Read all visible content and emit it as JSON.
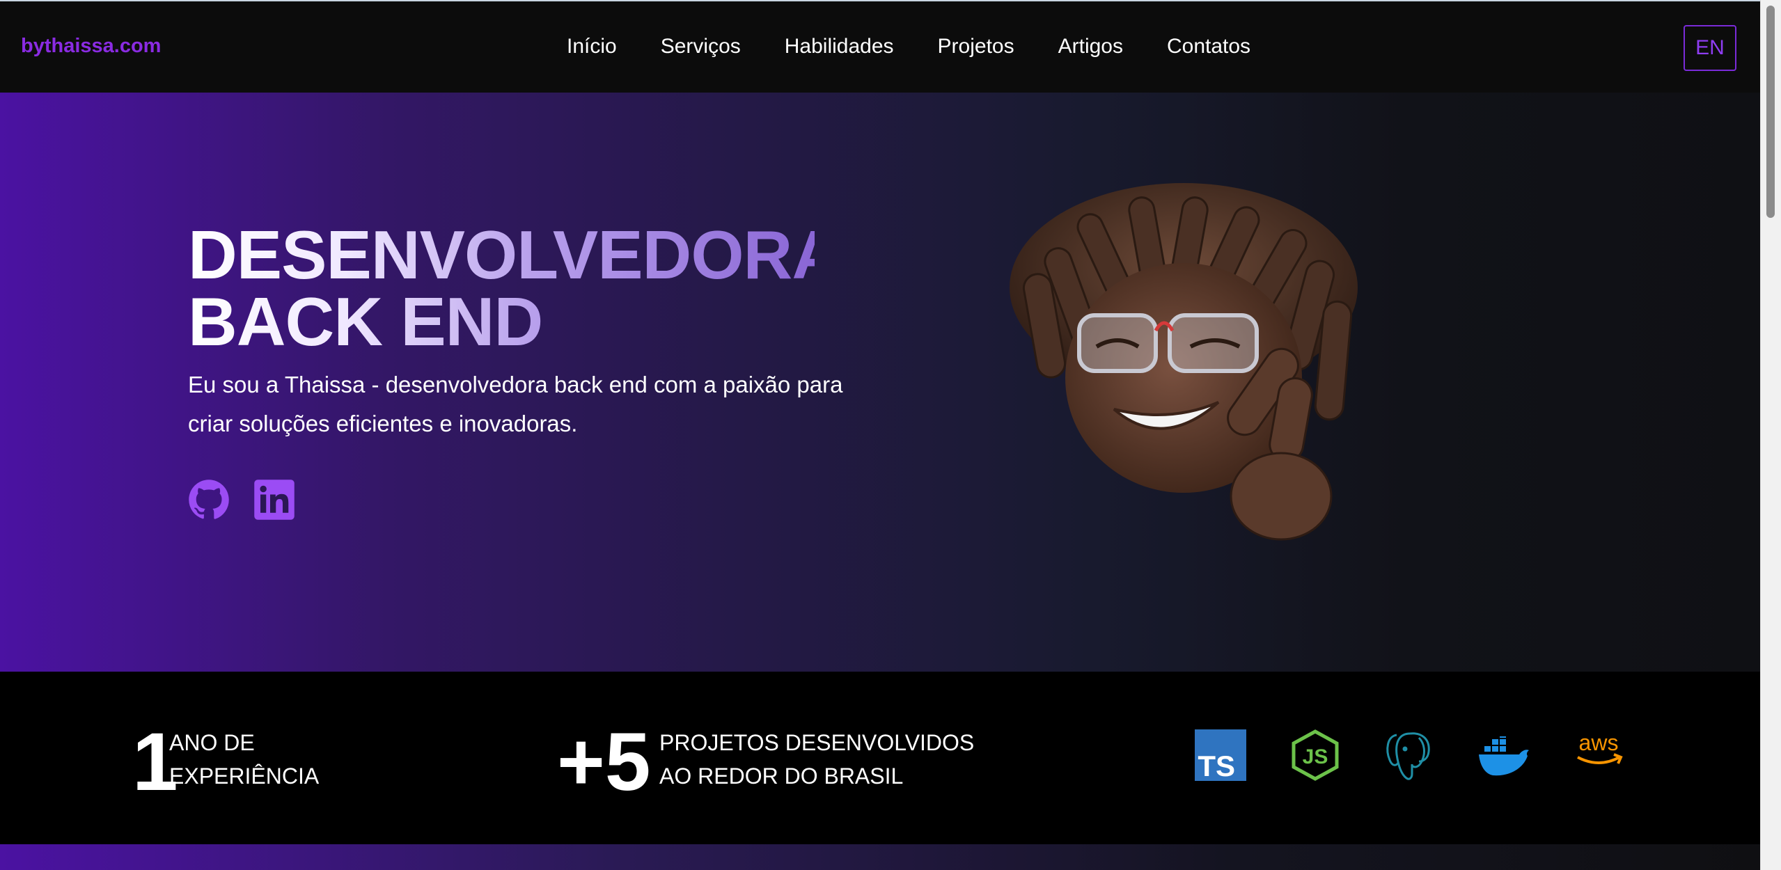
{
  "nav": {
    "brand": "bythaissa.com",
    "items": [
      {
        "label": "Início"
      },
      {
        "label": "Serviços"
      },
      {
        "label": "Habilidades"
      },
      {
        "label": "Projetos"
      },
      {
        "label": "Artigos"
      },
      {
        "label": "Contatos"
      }
    ],
    "language_button": "EN"
  },
  "hero": {
    "headline_line1": "DESENVOLVEDORA",
    "headline_line2": "BACK END",
    "subtitle": "Eu sou a Thaissa - desenvolvedora back end com a paixão para criar soluções eficientes e inovadoras.",
    "social_links": [
      {
        "icon": "github-icon"
      },
      {
        "icon": "linkedin-icon"
      }
    ],
    "avatar_icon": "memoji-avatar",
    "gradient_start": "#4b12a2",
    "gradient_end": "#0f1014"
  },
  "stats": {
    "experience": {
      "number": "1",
      "line1": "ANO DE",
      "line2": "EXPERIÊNCIA"
    },
    "projects": {
      "number": "+5",
      "line1": "PROJETOS DESENVOLVIDOS",
      "line2": "AO REDOR DO BRASIL"
    },
    "technologies": [
      {
        "icon": "typescript-icon",
        "label": "TS",
        "color": "#2f74c0"
      },
      {
        "icon": "nodejs-icon",
        "label": "JS",
        "color": "#6cc24a"
      },
      {
        "icon": "postgresql-icon",
        "color": "#1f8fa6"
      },
      {
        "icon": "docker-icon",
        "color": "#1d91e6"
      },
      {
        "icon": "aws-icon",
        "label": "aws",
        "color": "#f79400"
      }
    ]
  },
  "colors": {
    "accent": "#8a2be2",
    "nav_bg": "#0c0c0c",
    "stats_bg": "#000000"
  }
}
